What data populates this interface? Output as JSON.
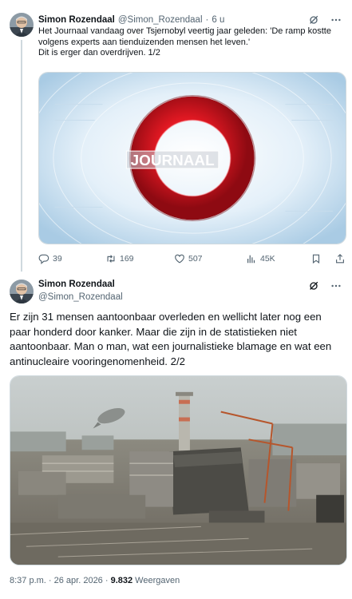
{
  "tweet1": {
    "author_name": "Simon Rozendaal",
    "author_handle": "@Simon_Rozendaal",
    "separator": "·",
    "time": "6 u",
    "text_lines": [
      "Het Journaal vandaag over Tsjernobyl veertig jaar geleden: 'De ramp kostte",
      "volgens experts aan tienduizenden mensen het leven.'",
      "Dit is erger dan overdrijven. 1/2"
    ],
    "media": {
      "logo_text": "JOURNAAL"
    },
    "stats": {
      "replies": "39",
      "reposts": "169",
      "likes": "507",
      "views": "45K"
    },
    "icons": [
      "grok-icon",
      "more-icon",
      "reply-icon",
      "repost-icon",
      "like-icon",
      "views-icon",
      "bookmark-icon",
      "share-icon"
    ]
  },
  "tweet2": {
    "author_name": "Simon Rozendaal",
    "author_handle": "@Simon_Rozendaal",
    "text": "Er zijn 31 mensen aantoonbaar overleden en wellicht later nog een paar honderd door kanker. Maar die zijn in de statistieken niet aantoonbaar. Man o man, wat een journalistieke blamage en wat een antinucleaire vooringenomenheid. 2/2",
    "timestamp": "8:37 p.m. · 26 apr. 2026 · ",
    "views_count": "9.832",
    "views_label": " Weergaven"
  },
  "colors": {
    "text_primary": "#0f1419",
    "text_secondary": "#536471",
    "border": "#cfd9de",
    "journaal_red": "#d4141e",
    "journaal_bg": "#cfe3f2"
  }
}
